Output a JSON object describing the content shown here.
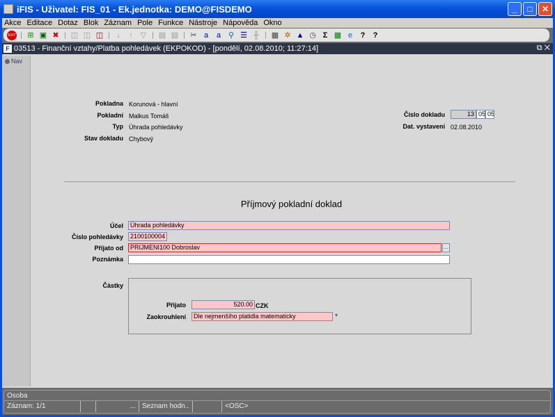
{
  "window": {
    "title": "iFIS - Uživatel: FIS_01 - Ek.jednotka: DEMO@FISDEMO"
  },
  "menu": [
    "Akce",
    "Editace",
    "Dotaz",
    "Blok",
    "Záznam",
    "Pole",
    "Funkce",
    "Nástroje",
    "Nápověda",
    "Okno"
  ],
  "toolbar_icons": [
    "exit-icon",
    "new-record-icon",
    "save-icon",
    "delete-icon",
    "query-icon",
    "execute-query-icon",
    "cancel-query-icon",
    "sort-asc-icon",
    "sort-desc-icon",
    "filter-icon",
    "print-icon",
    "print-setup-icon",
    "cut-icon",
    "copy-icon",
    "paste-icon",
    "find-icon",
    "list-icon",
    "columns-icon",
    "calendar-icon",
    "settings-icon",
    "chart-icon",
    "clock-icon",
    "sum-icon",
    "excel-icon",
    "ie-icon",
    "help-icon",
    "context-help-icon"
  ],
  "inner": {
    "title": "03513 - Finanční vztahy/Platba pohledávek (EKPOKOD) - [pondělí, 02.08.2010; 11:27:14]"
  },
  "nav": {
    "label": "Nav"
  },
  "header": {
    "pokladna_label": "Pokladna",
    "pokladna": "Korunová - hlavní",
    "pokladni_label": "Pokladní",
    "pokladni": "Malkus Tomáš",
    "typ_label": "Typ",
    "typ": "Úhrada pohledávky",
    "stav_label": "Stav dokladu",
    "stav": "Chybový",
    "cislo_label": "Číslo dokladu",
    "cislo": [
      "13",
      "05",
      "05"
    ],
    "dat_label": "Dat. vystavení",
    "dat": "02.08.2010"
  },
  "form": {
    "heading": "Příjmový pokladní doklad",
    "ucel_label": "Účel",
    "ucel": "Úhrada pohledávky",
    "cislo_pohl_label": "Číslo pohledávky",
    "cislo_pohl": "2100100004",
    "prijato_od_label": "Přijato od",
    "prijato_od": "PRIJMENI100 Dobroslav",
    "poznamka_label": "Poznámka",
    "poznamka": "",
    "castky_label": "Částky",
    "prijato_label": "Přijato",
    "prijato": "520.00",
    "mena": "CZK",
    "zaokrouhleni_label": "Zaokrouhlení",
    "zaokrouhleni": "Dle nejmenšího platidla matematicky"
  },
  "status": {
    "field": "Osoba",
    "zaznam": "Záznam: 1/1",
    "cell3": "...",
    "list": "Seznam hodn..",
    "mode": "<OSC>"
  }
}
